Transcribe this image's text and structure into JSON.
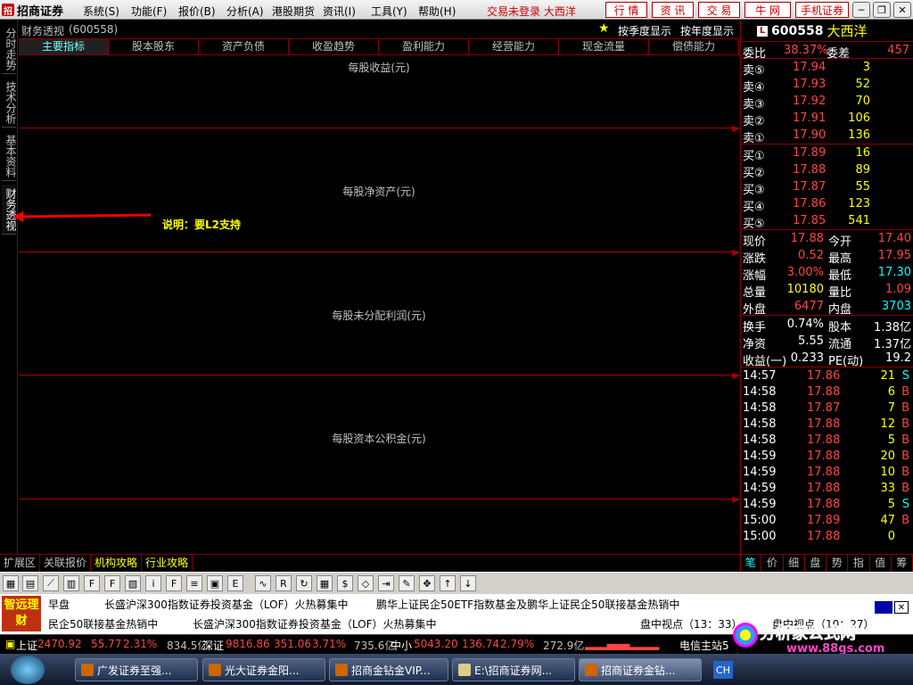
{
  "menubar": {
    "app_title": "招商证券",
    "items": [
      "系统(S)",
      "功能(F)",
      "报价(B)",
      "分析(A)",
      "港股期货",
      "资讯(I)",
      "工具(Y)",
      "帮助(H)"
    ],
    "status": "交易未登录  大西洋",
    "buttons": [
      "行 情",
      "资 讯",
      "交 易",
      "牛 网",
      "手机证券"
    ]
  },
  "left_tabs": [
    "分时走势",
    "技术分析",
    "基本资料",
    "财务透视"
  ],
  "title": {
    "label": "财务透视",
    "code": "(600558)",
    "quarter": "按季度显示",
    "year": "按年度显示"
  },
  "fin_tabs": [
    "主要指标",
    "股本股东",
    "资产负债",
    "收盈趋势",
    "盈利能力",
    "经营能力",
    "现金流量",
    "偿债能力"
  ],
  "sections": [
    "每股收益(元)",
    "每股净资产(元)",
    "每股未分配利润(元)",
    "每股资本公积金(元)"
  ],
  "note": "说明：要L2支持",
  "bottom_tabs": [
    "扩展区",
    "关联报价",
    "机构攻略",
    "行业攻略"
  ],
  "stock": {
    "code": "600558",
    "name": "大西洋",
    "ratio_label": "委比",
    "ratio": "38.37%",
    "diff_label": "委差",
    "diff": "457",
    "sells": [
      {
        "label": "卖⑤",
        "price": "17.94",
        "vol": "3"
      },
      {
        "label": "卖④",
        "price": "17.93",
        "vol": "52"
      },
      {
        "label": "卖③",
        "price": "17.92",
        "vol": "70"
      },
      {
        "label": "卖②",
        "price": "17.91",
        "vol": "106"
      },
      {
        "label": "卖①",
        "price": "17.90",
        "vol": "136"
      }
    ],
    "buys": [
      {
        "label": "买①",
        "price": "17.89",
        "vol": "16"
      },
      {
        "label": "买②",
        "price": "17.88",
        "vol": "89"
      },
      {
        "label": "买③",
        "price": "17.87",
        "vol": "55"
      },
      {
        "label": "买④",
        "price": "17.86",
        "vol": "123"
      },
      {
        "label": "买⑤",
        "price": "17.85",
        "vol": "541"
      }
    ],
    "quote": [
      {
        "l1": "现价",
        "v1": "17.88",
        "l2": "今开",
        "v2": "17.40"
      },
      {
        "l1": "涨跌",
        "v1": "0.52",
        "l2": "最高",
        "v2": "17.95"
      },
      {
        "l1": "涨幅",
        "v1": "3.00%",
        "l2": "最低",
        "v2": "17.30"
      },
      {
        "l1": "总量",
        "v1": "10180",
        "l2": "量比",
        "v2": "1.09"
      },
      {
        "l1": "外盘",
        "v1": "6477",
        "l2": "内盘",
        "v2": "3703"
      }
    ],
    "info": [
      {
        "l1": "换手",
        "v1": "0.74%",
        "l2": "股本",
        "v2": "1.38亿"
      },
      {
        "l1": "净资",
        "v1": "5.55",
        "l2": "流通",
        "v2": "1.37亿"
      },
      {
        "l1": "收益(一)",
        "v1": "0.233",
        "l2": "PE(动)",
        "v2": "19.2"
      }
    ],
    "ticks": [
      {
        "t": "14:57",
        "p": "17.86",
        "v": "21",
        "s": "S"
      },
      {
        "t": "14:58",
        "p": "17.88",
        "v": "6",
        "s": "B"
      },
      {
        "t": "14:58",
        "p": "17.87",
        "v": "7",
        "s": "B"
      },
      {
        "t": "14:58",
        "p": "17.88",
        "v": "12",
        "s": "B"
      },
      {
        "t": "14:58",
        "p": "17.88",
        "v": "5",
        "s": "B"
      },
      {
        "t": "14:59",
        "p": "17.88",
        "v": "20",
        "s": "B"
      },
      {
        "t": "14:59",
        "p": "17.88",
        "v": "10",
        "s": "B"
      },
      {
        "t": "14:59",
        "p": "17.88",
        "v": "33",
        "s": "B"
      },
      {
        "t": "14:59",
        "p": "17.88",
        "v": "5",
        "s": "S"
      },
      {
        "t": "15:00",
        "p": "17.89",
        "v": "47",
        "s": "B"
      },
      {
        "t": "15:00",
        "p": "17.88",
        "v": "0",
        "s": ""
      }
    ]
  },
  "right_tabs": [
    "笔",
    "价",
    "细",
    "盘",
    "势",
    "指",
    "值",
    "筹"
  ],
  "news": {
    "logo": "智远理财",
    "line1_a": "早盘",
    "line1_b": "长盛沪深300指数证券投资基金（LOF）火热募集中",
    "line1_c": "鹏华上证民企50ETF指数基金及鹏华上证民企50联接基金热销中",
    "line2_a": "民企50联接基金热销中",
    "line2_b": "长盛沪深300指数证券投资基金（LOF）火热募集中",
    "line2_c": "盘中视点（13：33）",
    "line2_d": "盘中视点（10：27）"
  },
  "status": {
    "sh_label": "上证",
    "sh_val": "2470.92",
    "sh_chg": "55.77",
    "sh_pct": "2.31%",
    "sh_amt": "834.5亿",
    "sz_label": "深证",
    "sz_val": "9816.86",
    "sz_chg": "351.06",
    "sz_pct": "3.71%",
    "sz_amt": "735.6亿",
    "zx_label": "中小",
    "zx_val": "5043.20",
    "zx_chg": "136.74",
    "zx_pct": "2.79%",
    "zx_amt": "272.9亿",
    "server": "电信主站5"
  },
  "brand": {
    "big": "分析家公式网",
    "small": "www.88gs.com"
  },
  "taskbar": [
    "广发证券至强...",
    "光大证券金阳...",
    "招商金钻金VIP...",
    "E:\\招商证券网...",
    "招商证券金钻..."
  ],
  "tray": "CH"
}
